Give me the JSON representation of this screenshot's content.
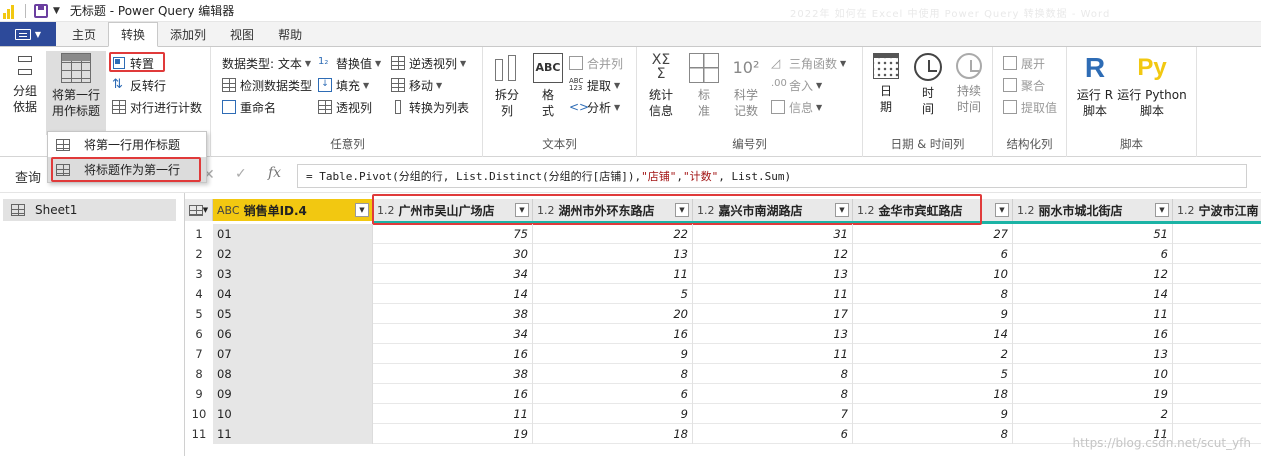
{
  "window": {
    "title": "无标题 - Power Query 编辑器",
    "blurred_title": "2022年 如何在 Excel 中使用 Power Query 转换数据 - Word"
  },
  "tabs": [
    "主页",
    "转换",
    "添加列",
    "视图",
    "帮助"
  ],
  "active_tab": "转换",
  "ribbon": {
    "group_label_table": "",
    "group_by": "分组\n依据",
    "first_row_header": "将第一行\n用作标题",
    "transpose": "转置",
    "reverse_rows": "反转行",
    "count_rows": "对行进行计数",
    "data_type": "数据类型: 文本",
    "detect_type": "检测数据类型",
    "rename": "重命名",
    "replace_values": "替换值",
    "fill": "填充",
    "pivot": "透视列",
    "unpivot": "逆透视列",
    "move": "移动",
    "to_list": "转换为列表",
    "group_any_column": "任意列",
    "split": "拆分\n列",
    "format": "格\n式",
    "merge_cols": "合并列",
    "extract": "提取",
    "parse": "分析",
    "group_text": "文本列",
    "statistics": "统计\n信息",
    "standard": "标\n准",
    "scientific": "科学\n记数",
    "trig": "三角函数",
    "rounding": "舍入",
    "information": "信息",
    "group_number": "编号列",
    "date": "日\n期",
    "time": "时\n间",
    "duration": "持续\n时间",
    "group_datetime": "日期 & 时间列",
    "expand": "展开",
    "aggregate": "聚合",
    "extract_values": "提取值",
    "group_structured": "结构化列",
    "run_r": "运行 R\n脚本",
    "run_python": "运行 Python\n脚本",
    "group_script": "脚本"
  },
  "menu": {
    "item1": "将第一行用作标题",
    "item2": "将标题作为第一行"
  },
  "query_label": "查询",
  "formula": {
    "prefix": "= Table.Pivot(分组的行, List.Distinct(分组的行[店铺]), ",
    "s1": "\"店铺\"",
    "mid": ", ",
    "s2": "\"计数\"",
    "suffix": ", List.Sum)"
  },
  "queries": [
    "Sheet1"
  ],
  "table": {
    "first_col": {
      "type": "ABC",
      "name": "销售单ID.4"
    },
    "columns": [
      {
        "type": "1.2",
        "name": "广州市吴山广场店"
      },
      {
        "type": "1.2",
        "name": "湖州市外环东路店"
      },
      {
        "type": "1.2",
        "name": "嘉兴市南湖路店"
      },
      {
        "type": "1.2",
        "name": "金华市宾虹路店"
      },
      {
        "type": "1.2",
        "name": "丽水市城北街店"
      },
      {
        "type": "1.2",
        "name": "宁波市江南"
      }
    ],
    "rows": [
      {
        "n": "1",
        "id": "01",
        "v": [
          "75",
          "22",
          "31",
          "27",
          "51"
        ]
      },
      {
        "n": "2",
        "id": "02",
        "v": [
          "30",
          "13",
          "12",
          "6",
          "6"
        ]
      },
      {
        "n": "3",
        "id": "03",
        "v": [
          "34",
          "11",
          "13",
          "10",
          "12"
        ]
      },
      {
        "n": "4",
        "id": "04",
        "v": [
          "14",
          "5",
          "11",
          "8",
          "14"
        ]
      },
      {
        "n": "5",
        "id": "05",
        "v": [
          "38",
          "20",
          "17",
          "9",
          "11"
        ]
      },
      {
        "n": "6",
        "id": "06",
        "v": [
          "34",
          "16",
          "13",
          "14",
          "16"
        ]
      },
      {
        "n": "7",
        "id": "07",
        "v": [
          "16",
          "9",
          "11",
          "2",
          "13"
        ]
      },
      {
        "n": "8",
        "id": "08",
        "v": [
          "38",
          "8",
          "8",
          "5",
          "10"
        ]
      },
      {
        "n": "9",
        "id": "09",
        "v": [
          "16",
          "6",
          "8",
          "18",
          "19"
        ]
      },
      {
        "n": "10",
        "id": "10",
        "v": [
          "11",
          "9",
          "7",
          "9",
          "2"
        ]
      },
      {
        "n": "11",
        "id": "11",
        "v": [
          "19",
          "18",
          "6",
          "8",
          "11"
        ]
      }
    ]
  },
  "watermark": "https://blog.csdn.net/scut_yfh",
  "colors": {
    "accent_yellow": "#f2c811",
    "highlight_red": "#e03a3a",
    "teal_bar": "#1bb3a5",
    "file_blue": "#2d4a9a"
  }
}
